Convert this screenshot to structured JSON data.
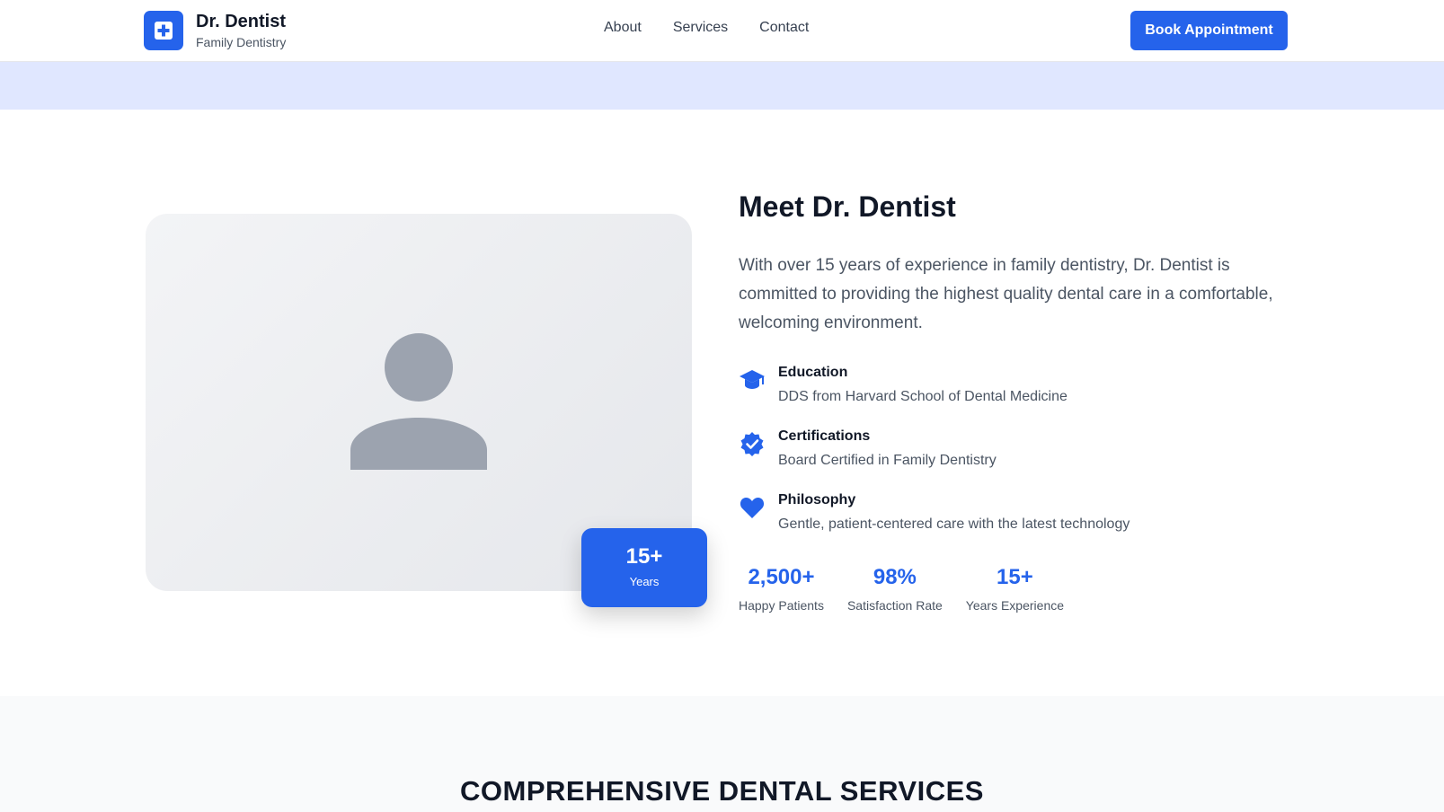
{
  "header": {
    "brand_title": "Dr. Dentist",
    "brand_subtitle": "Family Dentistry",
    "logo_icon": "medical-cross-icon",
    "nav": [
      {
        "label": "About"
      },
      {
        "label": "Services"
      },
      {
        "label": "Contact"
      }
    ],
    "cta_label": "Book Appointment"
  },
  "colors": {
    "accent": "#2563eb",
    "band": "#e0e7ff",
    "text_dark": "#111827",
    "text_muted": "#4b5563"
  },
  "about": {
    "badge_value": "15+",
    "badge_label": "Years",
    "title": "Meet Dr. Dentist",
    "bio": "With over 15 years of experience in family dentistry, Dr. Dentist is committed to providing the highest quality dental care in a comfortable, welcoming environment.",
    "features": [
      {
        "icon": "graduation-cap-icon",
        "title": "Education",
        "desc": "DDS from Harvard School of Dental Medicine"
      },
      {
        "icon": "verified-badge-icon",
        "title": "Certifications",
        "desc": "Board Certified in Family Dentistry"
      },
      {
        "icon": "heart-icon",
        "title": "Philosophy",
        "desc": "Gentle, patient-centered care with the latest technology"
      }
    ],
    "stats": [
      {
        "value": "2,500+",
        "label": "Happy Patients"
      },
      {
        "value": "98%",
        "label": "Satisfaction Rate"
      },
      {
        "value": "15+",
        "label": "Years Experience"
      }
    ]
  },
  "services": {
    "heading": "COMPREHENSIVE DENTAL SERVICES"
  }
}
